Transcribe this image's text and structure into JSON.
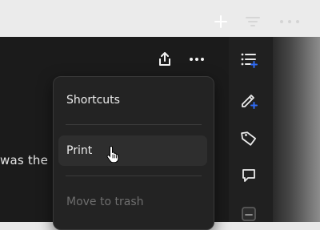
{
  "toolbar": {
    "add_icon": "plus-icon",
    "filter_icon": "filter-icon",
    "more_icon": "more-icon"
  },
  "panel": {
    "share_icon": "share-icon",
    "more_icon": "ellipsis-icon",
    "body_text": "was the r"
  },
  "menu": {
    "items": [
      {
        "label": "Shortcuts"
      },
      {
        "label": "Print"
      },
      {
        "label": "Move to trash"
      }
    ]
  },
  "sidebar": {
    "icons": [
      "list-add-icon",
      "pen-add-icon",
      "tag-icon",
      "comment-icon",
      "note-icon"
    ],
    "accent_color": "#2f6bf5"
  }
}
